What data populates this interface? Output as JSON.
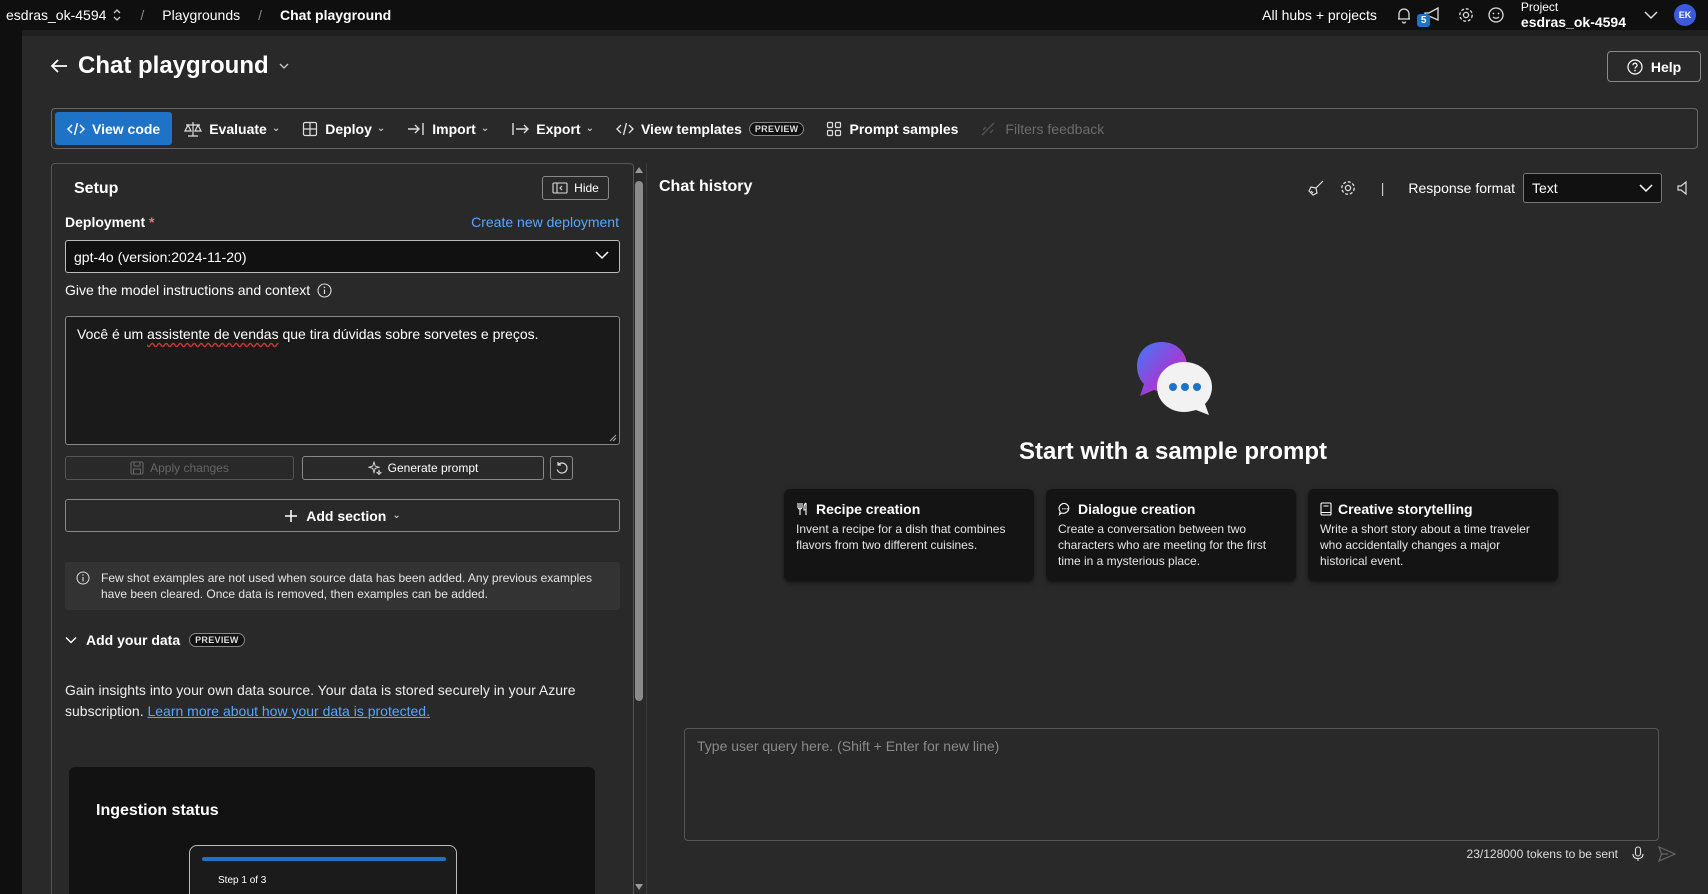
{
  "topbar": {
    "project_switcher": "esdras_ok-4594",
    "breadcrumb_1": "Playgrounds",
    "breadcrumb_2": "Chat playground",
    "hubs_link": "All hubs + projects",
    "notification_count": "5",
    "project_label": "Project",
    "project_name": "esdras_ok-4594",
    "avatar_initials": "EK"
  },
  "page": {
    "title": "Chat playground",
    "help_label": "Help"
  },
  "toolbar": {
    "view_code": "View code",
    "evaluate": "Evaluate",
    "deploy": "Deploy",
    "import": "Import",
    "export": "Export",
    "view_templates": "View templates",
    "preview_badge": "PREVIEW",
    "prompt_samples": "Prompt samples",
    "filters_feedback": "Filters feedback"
  },
  "setup": {
    "title": "Setup",
    "hide_label": "Hide",
    "deployment_label": "Deployment",
    "required_marker": "*",
    "create_deployment_link": "Create new deployment",
    "deployment_value": "gpt-4o (version:2024-11-20)",
    "instructions_label": "Give the model instructions and context",
    "instructions_value_pre": "Você é um ",
    "instructions_value_spell": "assistente de vendas",
    "instructions_value_post": " que tira dúvidas sobre sorvetes e preços.",
    "apply_changes": "Apply changes",
    "generate_prompt": "Generate prompt",
    "add_section": "Add section",
    "notice": "Few shot examples are not used when source data has been added. Any previous examples have been cleared. Once data is removed, then examples can be added.",
    "add_your_data": "Add your data",
    "preview_badge": "PREVIEW",
    "gain_text": "Gain insights into your own data source. Your data is stored securely in your Azure subscription. ",
    "gain_link": "Learn more about how your data is protected.",
    "ingestion_title": "Ingestion status",
    "step_label": "Step 1 of 3"
  },
  "chat": {
    "title": "Chat history",
    "response_format_label": "Response format",
    "response_format_value": "Text",
    "hero_text": "Start with a sample prompt",
    "cards": [
      {
        "title": "Recipe creation",
        "desc": "Invent a recipe for a dish that combines flavors from two different cuisines."
      },
      {
        "title": "Dialogue creation",
        "desc": "Create a conversation between two characters who are meeting for the first time in a mysterious place."
      },
      {
        "title": "Creative storytelling",
        "desc": "Write a short story about a time traveler who accidentally changes a major historical event."
      }
    ],
    "query_placeholder": "Type user query here. (Shift + Enter for new line)",
    "tokens_text": "23/128000 tokens to be sent"
  },
  "colors": {
    "accent": "#1f73c6",
    "link": "#58a6ff",
    "background": "#292929"
  }
}
